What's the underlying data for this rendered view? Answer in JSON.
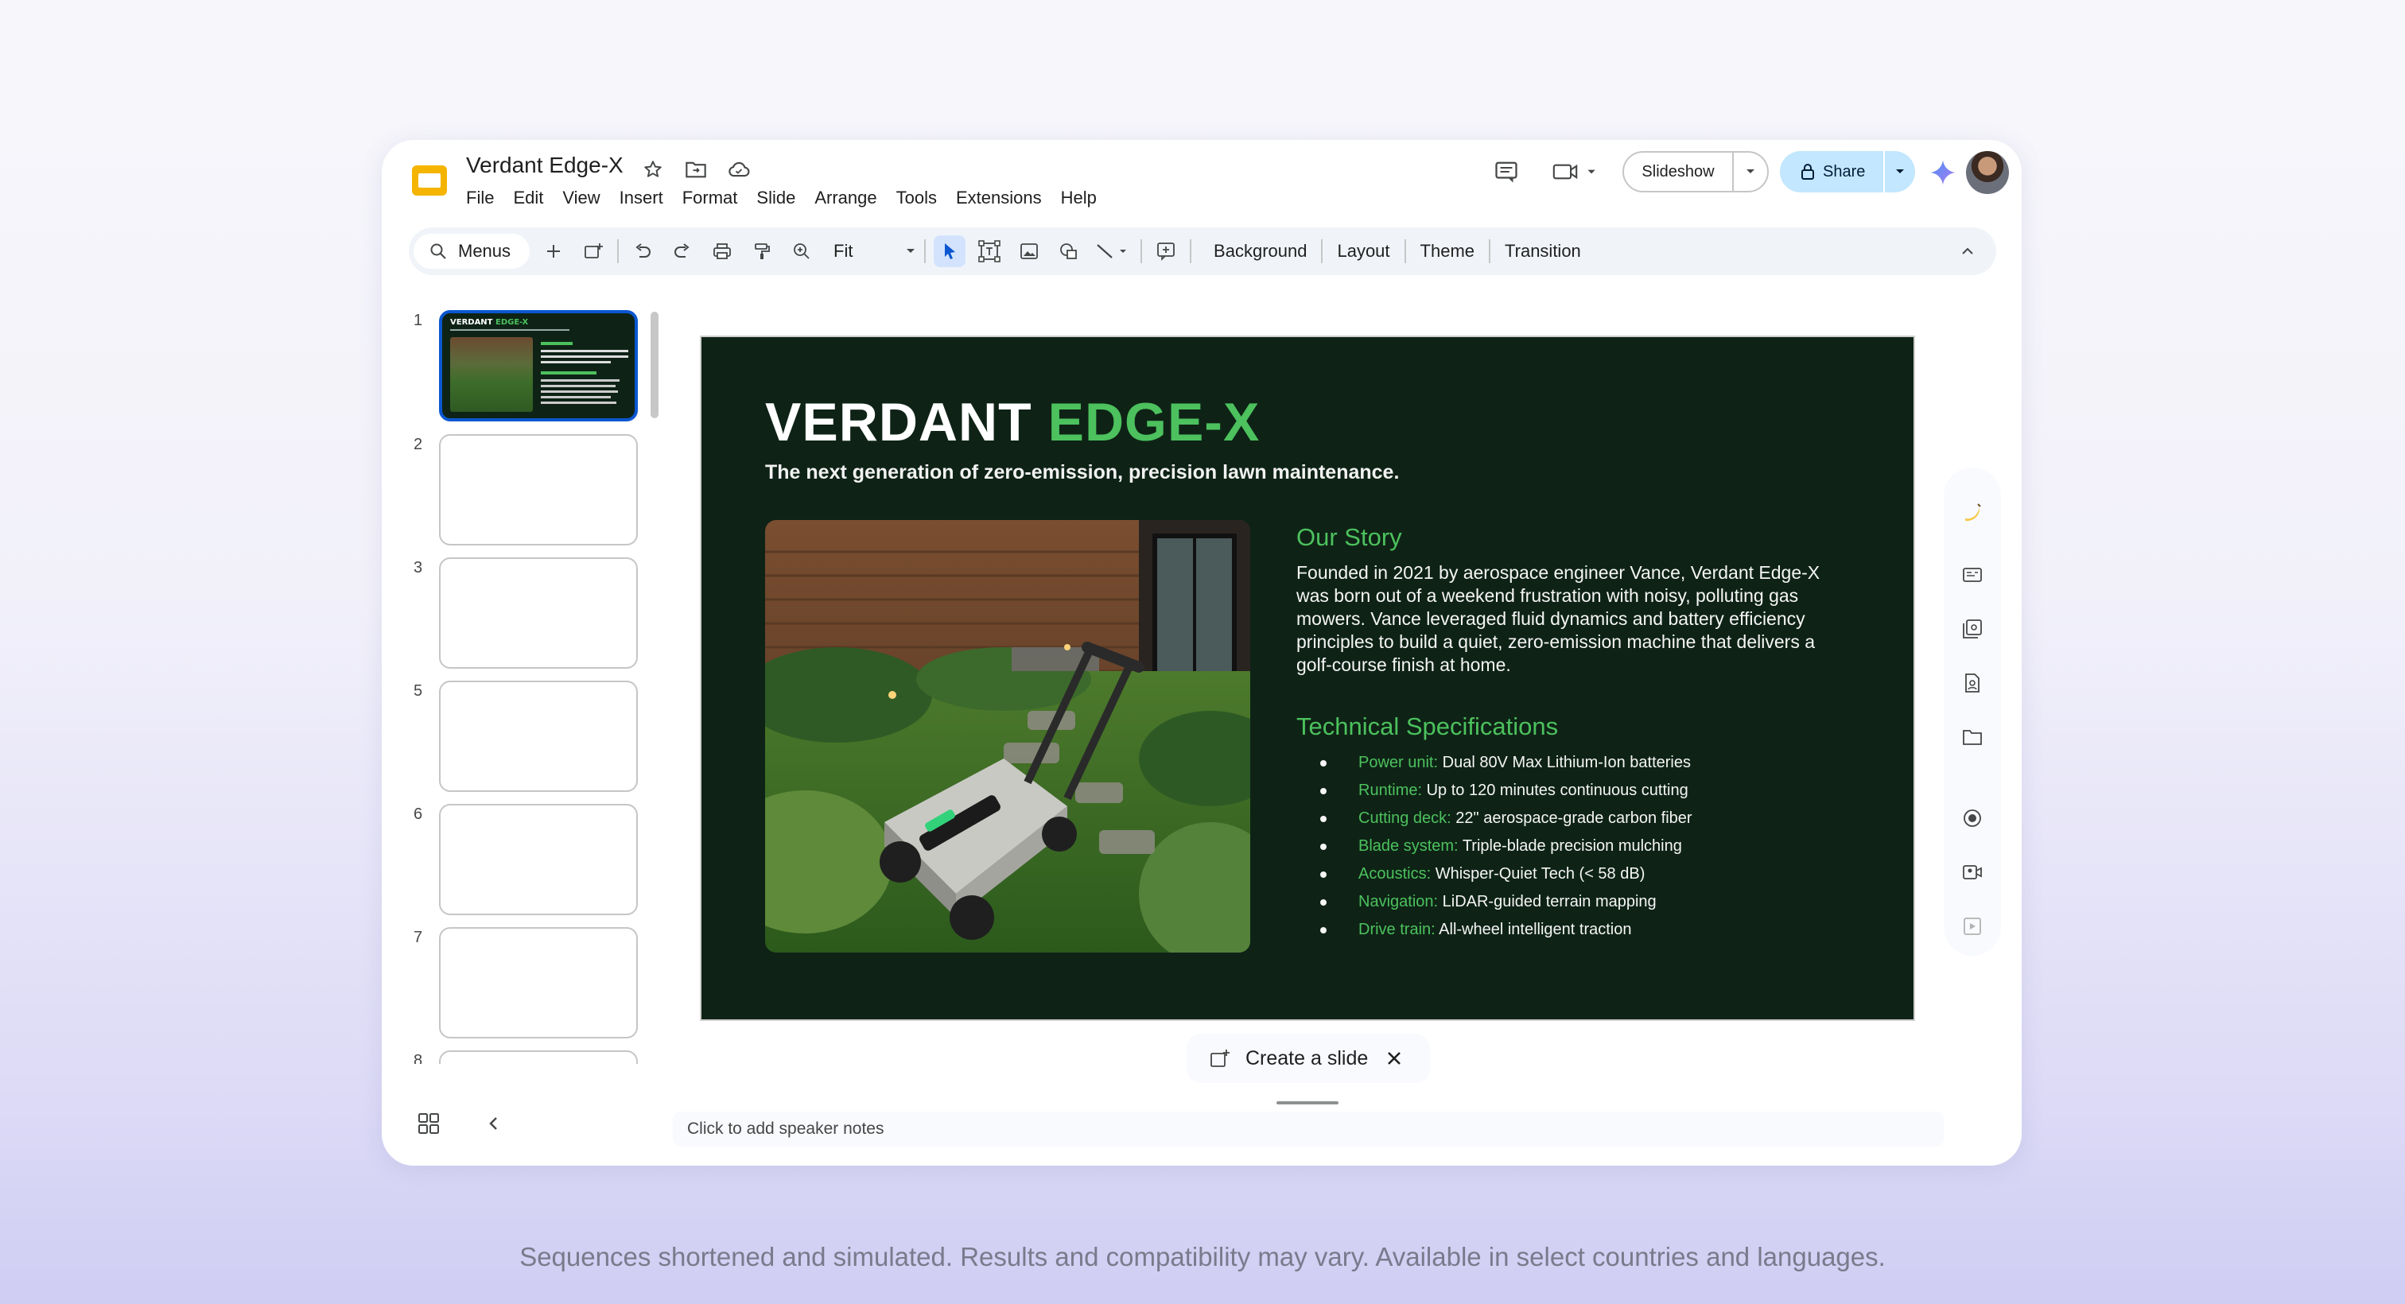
{
  "app": {
    "doc_title": "Verdant Edge-X",
    "menu": [
      "File",
      "Edit",
      "View",
      "Insert",
      "Format",
      "Slide",
      "Arrange",
      "Tools",
      "Extensions",
      "Help"
    ],
    "slideshow_label": "Slideshow",
    "share_label": "Share"
  },
  "toolbar": {
    "search_label": "Menus",
    "zoom_label": "Fit",
    "text_buttons": [
      "Background",
      "Layout",
      "Theme",
      "Transition"
    ]
  },
  "filmstrip": {
    "slide_numbers": [
      "1",
      "2",
      "3",
      "5",
      "6",
      "7",
      "8"
    ],
    "thumb1": {
      "title_a": "VERDANT",
      "title_b": "EDGE-X"
    }
  },
  "slide": {
    "title_a": "VERDANT",
    "title_b": "EDGE-X",
    "subtitle": "The next generation of zero-emission, precision lawn maintenance.",
    "story_heading": "Our Story",
    "story_text": "Founded in 2021 by aerospace engineer Vance, Verdant Edge-X was born out of a weekend frustration with noisy, polluting gas mowers. Vance leveraged fluid dynamics and battery efficiency principles to build a quiet, zero-emission machine that delivers a golf-course finish at home.",
    "specs_heading": "Technical Specifications",
    "specs": [
      {
        "key": "Power unit:",
        "value": "Dual 80V Max Lithium-Ion batteries"
      },
      {
        "key": "Runtime:",
        "value": "Up to 120 minutes continuous cutting"
      },
      {
        "key": "Cutting deck:",
        "value": "22\" aerospace-grade carbon fiber"
      },
      {
        "key": "Blade system:",
        "value": "Triple-blade precision mulching"
      },
      {
        "key": "Acoustics:",
        "value": "Whisper-Quiet Tech (< 58 dB)"
      },
      {
        "key": "Navigation:",
        "value": "LiDAR-guided terrain mapping"
      },
      {
        "key": "Drive train:",
        "value": "All-wheel intelligent traction"
      }
    ]
  },
  "create_slide_label": "Create a slide",
  "speaker_notes_placeholder": "Click to add speaker notes",
  "disclaimer": "Sequences shortened and simulated. Results and compatibility may vary. Available in select countries and languages.",
  "colors": {
    "accent_green": "#4cc15d",
    "slide_bg": "#0e2316",
    "share_bg": "#c2e7ff",
    "selection": "#0b57d0"
  }
}
